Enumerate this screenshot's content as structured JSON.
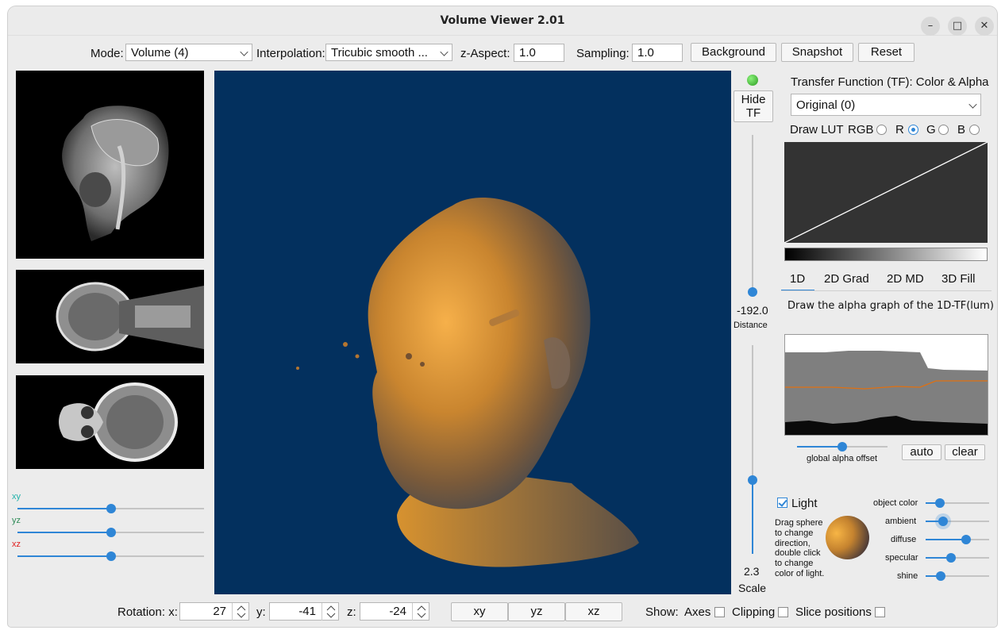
{
  "window": {
    "title": "Volume Viewer 2.01"
  },
  "toolbar": {
    "mode_label": "Mode:",
    "mode_value": "Volume (4)",
    "interp_label": "Interpolation:",
    "interp_value": "Tricubic smooth ...",
    "zaspect_label": "z-Aspect:",
    "zaspect_value": "1.0",
    "sampling_label": "Sampling:",
    "sampling_value": "1.0",
    "background_label": "Background",
    "snapshot_label": "Snapshot",
    "reset_label": "Reset"
  },
  "slices": {
    "xy_label": "xy",
    "yz_label": "yz",
    "xz_label": "xz",
    "xy_color": "#20b2aa",
    "yz_color": "#2e8b57",
    "xz_color": "#e02020",
    "xy_level": 0.5,
    "yz_level": 0.5,
    "xz_level": 0.5
  },
  "view": {
    "background_color": "#03305e",
    "hide_tf_line1": "Hide",
    "hide_tf_line2": "TF",
    "distance_value": "-192.0",
    "distance_label": "Distance",
    "scale_value": "2.3",
    "scale_label": "Scale"
  },
  "tf": {
    "title": "Transfer Function (TF): Color & Alpha",
    "preset": "Original (0)",
    "draw_lut_label": "Draw LUT",
    "rgb_label": "RGB",
    "r_label": "R",
    "g_label": "G",
    "b_label": "B",
    "selected_channel": "R",
    "tabs": [
      "1D",
      "2D Grad",
      "2D MD",
      "3D Fill"
    ],
    "active_tab": "1D",
    "hint": "Draw the alpha graph of the 1D-TF(lum)",
    "alpha_offset_label": "global alpha offset",
    "alpha_offset_level": 0.5,
    "auto_label": "auto",
    "clear_label": "clear"
  },
  "light": {
    "label": "Light",
    "checked": true,
    "hint_lines": [
      "Drag sphere",
      "to change",
      "direction,",
      "double click",
      "to change",
      "color of light."
    ],
    "params": [
      {
        "label": "object color",
        "level": 0.2
      },
      {
        "label": "ambient",
        "level": 0.3
      },
      {
        "label": "diffuse",
        "level": 0.65
      },
      {
        "label": "specular",
        "level": 0.45
      },
      {
        "label": "shine",
        "level": 0.25
      }
    ]
  },
  "bottom": {
    "rotation_label": "Rotation:  x:",
    "rot_x": "27",
    "y_label": "y:",
    "rot_y": "-41",
    "z_label": "z:",
    "rot_z": "-24",
    "xy_btn": "xy",
    "yz_btn": "yz",
    "xz_btn": "xz",
    "show_label": "Show:",
    "axes_label": "Axes",
    "clipping_label": "Clipping",
    "slicepos_label": "Slice positions"
  }
}
